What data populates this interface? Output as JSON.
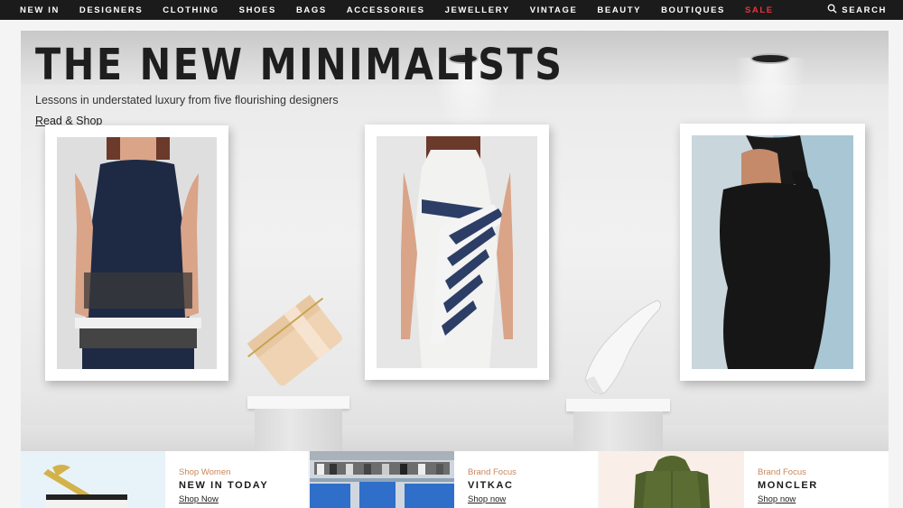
{
  "nav": {
    "items": [
      "NEW IN",
      "DESIGNERS",
      "CLOTHING",
      "SHOES",
      "BAGS",
      "ACCESSORIES",
      "JEWELLERY",
      "VINTAGE",
      "BEAUTY",
      "BOUTIQUES",
      "SALE"
    ],
    "search_label": "SEARCH",
    "sale_color": "#e8343c"
  },
  "hero": {
    "title": "THE NEW MINIMALISTS",
    "subtitle": "Lessons in understated luxury from five flourishing designers",
    "link": "Read & Shop"
  },
  "promos": [
    {
      "eyebrow": "Shop Women",
      "title": "NEW IN TODAY",
      "link": "Shop Now"
    },
    {
      "eyebrow": "Brand Focus",
      "title": "VITKAC",
      "link": "Shop now"
    },
    {
      "eyebrow": "Brand Focus",
      "title": "MONCLER",
      "link": "Shop now"
    }
  ],
  "colors": {
    "accent": "#c8865a",
    "nav_bg": "#1b1b1b"
  }
}
